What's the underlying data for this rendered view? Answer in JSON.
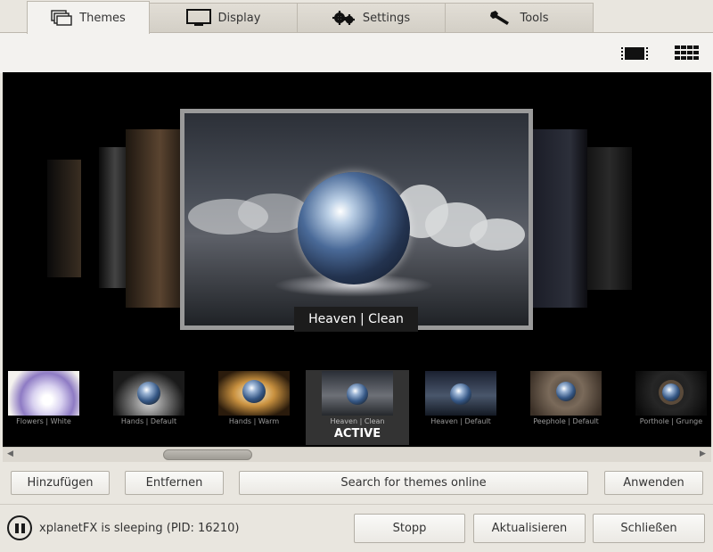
{
  "tabs": [
    {
      "label": "Themes",
      "icon": "windows-icon",
      "active": true
    },
    {
      "label": "Display",
      "icon": "monitor-icon",
      "active": false
    },
    {
      "label": "Settings",
      "icon": "gears-icon",
      "active": false
    },
    {
      "label": "Tools",
      "icon": "wrench-icon",
      "active": false
    }
  ],
  "view_buttons": {
    "coverflow": "film-icon",
    "grid": "grid-icon"
  },
  "preview": {
    "caption": "Heaven | Clean"
  },
  "thumbnails": [
    {
      "label": "Flowers | White",
      "active": false
    },
    {
      "label": "Hands | Default",
      "active": false
    },
    {
      "label": "Hands | Warm",
      "active": false
    },
    {
      "label": "Heaven | Clean",
      "active": true,
      "badge": "ACTIVE"
    },
    {
      "label": "Heaven | Default",
      "active": false
    },
    {
      "label": "Peephole | Default",
      "active": false
    },
    {
      "label": "Porthole | Grunge",
      "active": false
    }
  ],
  "actions": {
    "add": "Hinzufügen",
    "remove": "Entfernen",
    "search": "Search for themes online",
    "apply": "Anwenden"
  },
  "status": {
    "text": "xplanetFX is sleeping (PID: 16210)"
  },
  "footer": {
    "stop": "Stopp",
    "refresh": "Aktualisieren",
    "close": "Schließen"
  }
}
